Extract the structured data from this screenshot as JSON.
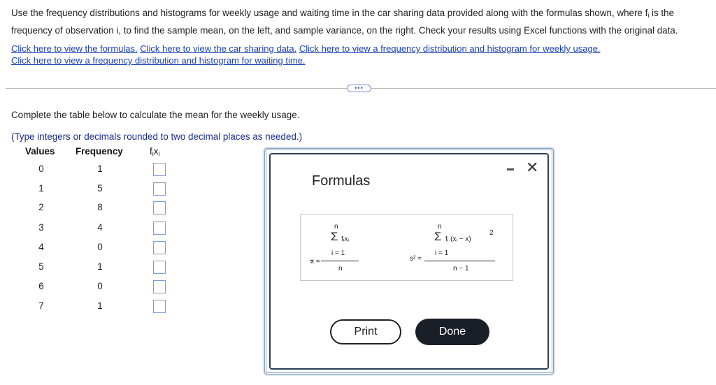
{
  "intro": {
    "line1_a": "Use the frequency distributions and histograms for weekly usage and waiting time in the car sharing data provided along with the formulas shown, where f",
    "line1_sub": "i",
    "line1_b": " is the",
    "line2": "frequency of observation  i, to find the sample mean, on the left, and sample variance, on the right. Check your results using Excel functions with the original data."
  },
  "links": {
    "formulas": "Click here to view the formulas.",
    "car_data": "Click here to view the car sharing data.",
    "weekly": "Click here to view a frequency distribution and histogram for weekly usage.",
    "waiting": "Click here to view a frequency distribution and histogram for waiting time."
  },
  "more_button": "•••",
  "instruction": "Complete the table below to calculate the mean for the weekly usage.",
  "hint": "(Type integers or decimals rounded to two decimal places as needed.)",
  "table": {
    "headers": {
      "values": "Values",
      "frequency": "Frequency",
      "fx": "f",
      "fx_sub": "i",
      "fx_x": "x",
      "fx_x_sub": "i"
    },
    "values": [
      "0",
      "1",
      "2",
      "3",
      "4",
      "5",
      "6",
      "7"
    ],
    "frequencies": [
      "1",
      "5",
      "8",
      "4",
      "0",
      "1",
      "0",
      "1"
    ]
  },
  "modal": {
    "title": "Formulas",
    "mean": {
      "top_n": "n",
      "sigma": "Σ",
      "numerator": "fᵢxᵢ",
      "bottom": "i = 1",
      "lhs": "x =",
      "bar": "_",
      "denominator": "n"
    },
    "variance": {
      "top_n": "n",
      "sigma": "Σ",
      "numerator": "fᵢ (xᵢ − x)",
      "exp": "2",
      "bottom": "i = 1",
      "lhs": "s² =",
      "denominator": "n − 1"
    },
    "print_label": "Print",
    "done_label": "Done"
  }
}
